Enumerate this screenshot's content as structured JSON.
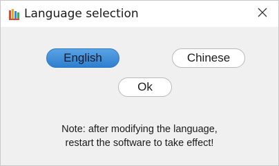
{
  "window": {
    "title": "Language selection",
    "icon": "app-logo-icon",
    "close_icon": "close-icon"
  },
  "languages": {
    "selected": "English",
    "options": [
      "English",
      "Chinese"
    ]
  },
  "ok_button": {
    "label": "Ok"
  },
  "note": {
    "line1": "Note: after modifying the language,",
    "line2": "restart the software to take effect!"
  },
  "colors": {
    "selected_fill": "#3d8fda",
    "background": "#f0f0f0",
    "titlebar": "#ffffff"
  }
}
